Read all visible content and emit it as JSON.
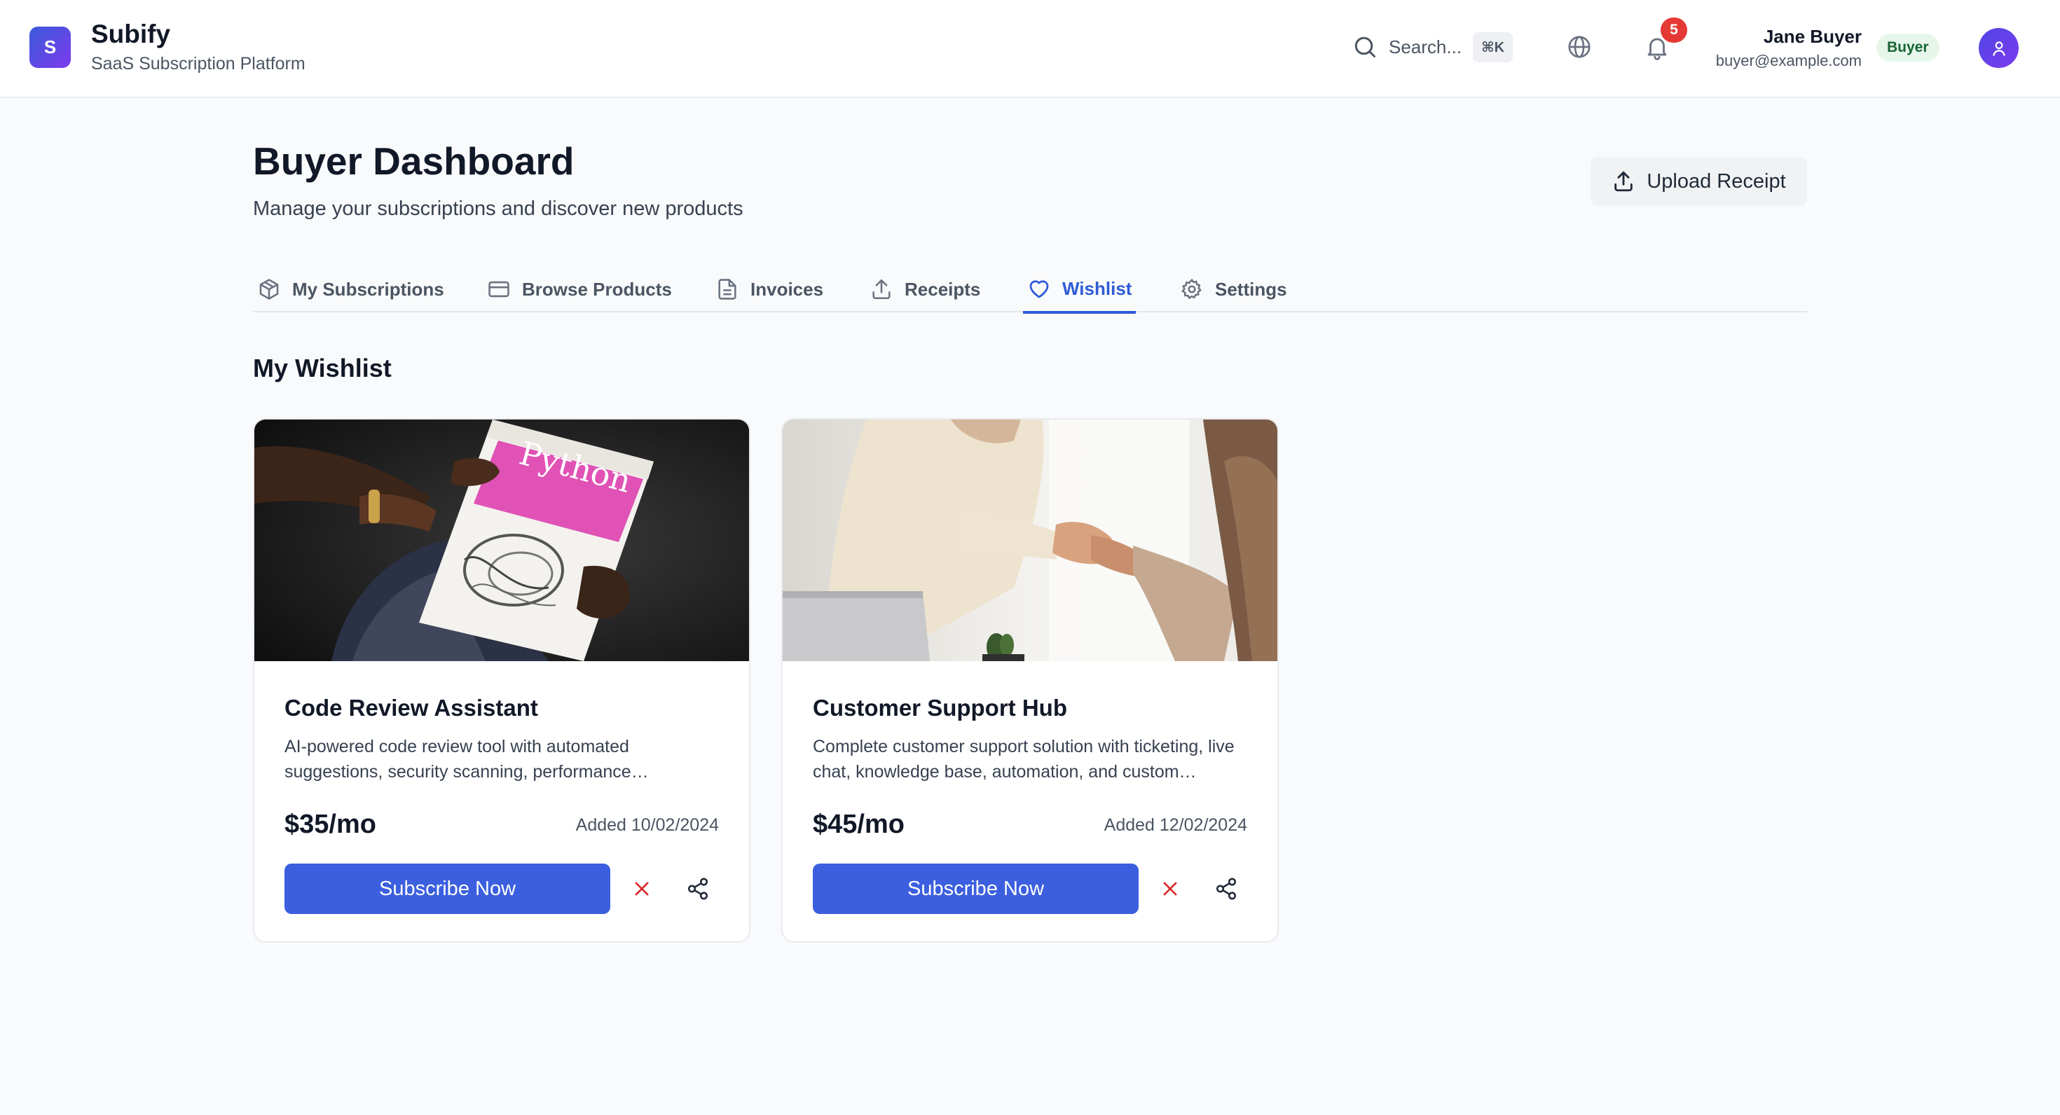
{
  "app": {
    "logo_letter": "S",
    "name": "Subify",
    "tagline": "SaaS Subscription Platform"
  },
  "header": {
    "search_placeholder": "Search...",
    "search_shortcut": "⌘K",
    "notifications_count": "5",
    "user": {
      "name": "Jane Buyer",
      "email": "buyer@example.com",
      "role": "Buyer"
    }
  },
  "page": {
    "title": "Buyer Dashboard",
    "subtitle": "Manage your subscriptions and discover new products",
    "upload_label": "Upload Receipt"
  },
  "tabs": [
    {
      "label": "My Subscriptions",
      "icon": "package-icon",
      "active": false
    },
    {
      "label": "Browse Products",
      "icon": "credit-card-icon",
      "active": false
    },
    {
      "label": "Invoices",
      "icon": "file-text-icon",
      "active": false
    },
    {
      "label": "Receipts",
      "icon": "upload-icon",
      "active": false
    },
    {
      "label": "Wishlist",
      "icon": "heart-icon",
      "active": true
    },
    {
      "label": "Settings",
      "icon": "gear-icon",
      "active": false
    }
  ],
  "wishlist": {
    "title": "My Wishlist",
    "items": [
      {
        "name": "Code Review Assistant",
        "description": "AI-powered code review tool with automated suggestions, security scanning, performance…",
        "price": "$35/mo",
        "added": "Added 10/02/2024",
        "subscribe_label": "Subscribe Now",
        "image_book_title": "Python"
      },
      {
        "name": "Customer Support Hub",
        "description": "Complete customer support solution with ticketing, live chat, knowledge base, automation, and custom…",
        "price": "$45/mo",
        "added": "Added 12/02/2024",
        "subscribe_label": "Subscribe Now"
      }
    ]
  },
  "colors": {
    "accent": "#3b5fde",
    "active_tab": "#2f5bd8",
    "badge_red": "#e53935",
    "role_badge_bg": "#e6f6ea",
    "remove_red": "#dc2626"
  }
}
